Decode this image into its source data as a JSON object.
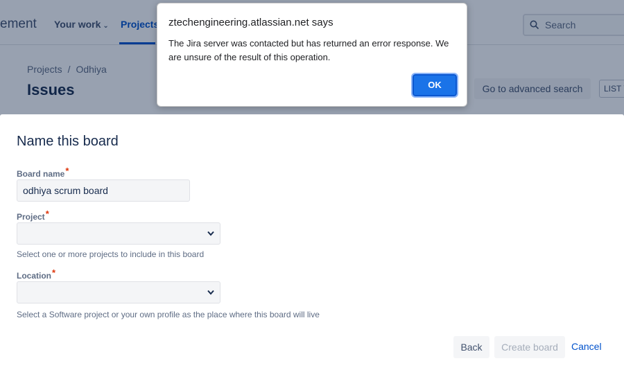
{
  "background": {
    "brand_partial": "ement",
    "nav": {
      "your_work": "Your work",
      "projects": "Projects"
    },
    "search_placeholder": "Search",
    "breadcrumb": {
      "projects": "Projects",
      "separator": "/",
      "project_name": "Odhiya"
    },
    "page_title": "Issues",
    "advanced_search_label": "Go to advanced search",
    "list_view_label": "LIST V"
  },
  "alert": {
    "title": "ztechengineering.atlassian.net says",
    "message": "The Jira server was contacted but has returned an error response. We are unsure of the result of this operation.",
    "ok_label": "OK"
  },
  "dialog": {
    "title": "Name this board",
    "board_name": {
      "label": "Board name",
      "required_mark": "*",
      "value": "odhiya scrum board"
    },
    "project": {
      "label": "Project",
      "required_mark": "*",
      "value": "",
      "help": "Select one or more projects to include in this board"
    },
    "location": {
      "label": "Location",
      "required_mark": "*",
      "value": "",
      "help": "Select a Software project or your own profile as the place where this board will live"
    },
    "buttons": {
      "back": "Back",
      "create": "Create board",
      "cancel": "Cancel"
    }
  },
  "colors": {
    "primary": "#0052cc",
    "required": "#de350b",
    "alert_button": "#1a73e8"
  }
}
